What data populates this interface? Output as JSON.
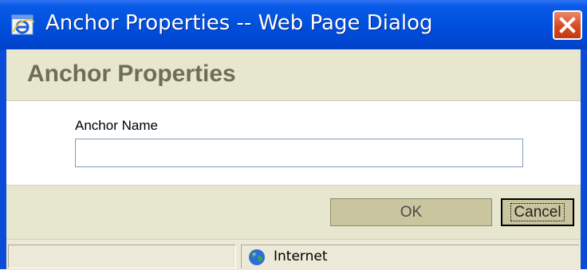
{
  "window": {
    "title": "Anchor Properties -- Web Page Dialog",
    "icon": "ie-icon",
    "close_icon": "close-icon"
  },
  "dialog": {
    "heading": "Anchor Properties",
    "anchor_name_label": "Anchor Name",
    "anchor_name_value": "",
    "ok_label": "OK",
    "cancel_label": "Cancel"
  },
  "status_bar": {
    "zone_label": "Internet",
    "zone_icon": "globe-icon"
  },
  "colors": {
    "titlebar": "#0052de",
    "panel": "#e7e6cf",
    "button": "#c9c59f",
    "close": "#d74a22"
  }
}
